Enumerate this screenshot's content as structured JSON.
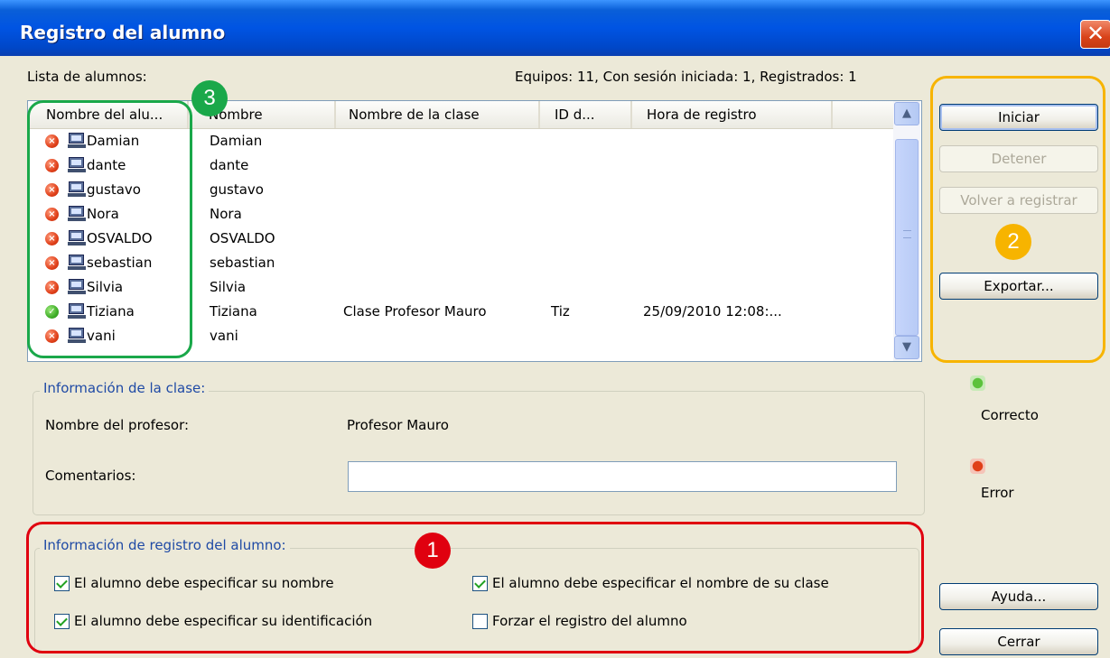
{
  "window": {
    "title": "Registro del alumno",
    "close_glyph": "✕"
  },
  "list": {
    "label": "Lista de alumnos:",
    "summary": "Equipos: 11, Con sesión iniciada: 1, Registrados: 1",
    "columns": [
      "Nombre del alu...",
      "Nombre",
      "Nombre de la clase",
      "ID d...",
      "Hora de registro"
    ],
    "rows": [
      {
        "status": "error",
        "computer": "Damian",
        "name": "Damian",
        "class": "",
        "id": "",
        "time": ""
      },
      {
        "status": "error",
        "computer": "dante",
        "name": "dante",
        "class": "",
        "id": "",
        "time": ""
      },
      {
        "status": "error",
        "computer": "gustavo",
        "name": "gustavo",
        "class": "",
        "id": "",
        "time": ""
      },
      {
        "status": "error",
        "computer": "Nora",
        "name": "Nora",
        "class": "",
        "id": "",
        "time": ""
      },
      {
        "status": "error",
        "computer": "OSVALDO",
        "name": "OSVALDO",
        "class": "",
        "id": "",
        "time": ""
      },
      {
        "status": "error",
        "computer": "sebastian",
        "name": "sebastian",
        "class": "",
        "id": "",
        "time": ""
      },
      {
        "status": "error",
        "computer": "Silvia",
        "name": "Silvia",
        "class": "",
        "id": "",
        "time": ""
      },
      {
        "status": "ok",
        "computer": "Tiziana",
        "name": "Tiziana",
        "class": "Clase Profesor Mauro",
        "id": "Tiz",
        "time": "25/09/2010 12:08:..."
      },
      {
        "status": "error",
        "computer": "vani",
        "name": "vani",
        "class": "",
        "id": "",
        "time": ""
      }
    ],
    "scroll_up": "▲",
    "scroll_down": "▼"
  },
  "class_info": {
    "title": "Información de la clase:",
    "teacher_label": "Nombre del profesor:",
    "teacher_value": "Profesor Mauro",
    "comments_label": "Comentarios:",
    "comments_value": ""
  },
  "registration": {
    "title": "Información de registro del alumno:",
    "options": [
      {
        "label": "El alumno debe especificar su nombre",
        "checked": true
      },
      {
        "label": "El alumno debe especificar el nombre de su clase",
        "checked": true
      },
      {
        "label": "El alumno debe especificar su identificación",
        "checked": true
      },
      {
        "label": "Forzar el registro del alumno",
        "checked": false
      }
    ]
  },
  "buttons": {
    "start": "Iniciar",
    "stop": "Detener",
    "reregister": "Volver a registrar",
    "export": "Exportar...",
    "help": "Ayuda...",
    "close": "Cerrar"
  },
  "legend": {
    "ok": "Correcto",
    "error": "Error"
  },
  "annotations": {
    "badge1": "1",
    "badge2": "2",
    "badge3": "3",
    "colors": {
      "red": "#e0000f",
      "orange": "#f7b400",
      "green": "#1aa84a"
    }
  },
  "colors": {
    "title_bar": "#0054e3",
    "group_title": "#1f4aa5",
    "status_error": "#e0401a",
    "status_ok": "#3fae28"
  },
  "icons": {
    "status_error": "error-icon",
    "status_ok": "check-icon",
    "computer": "computer-icon"
  }
}
